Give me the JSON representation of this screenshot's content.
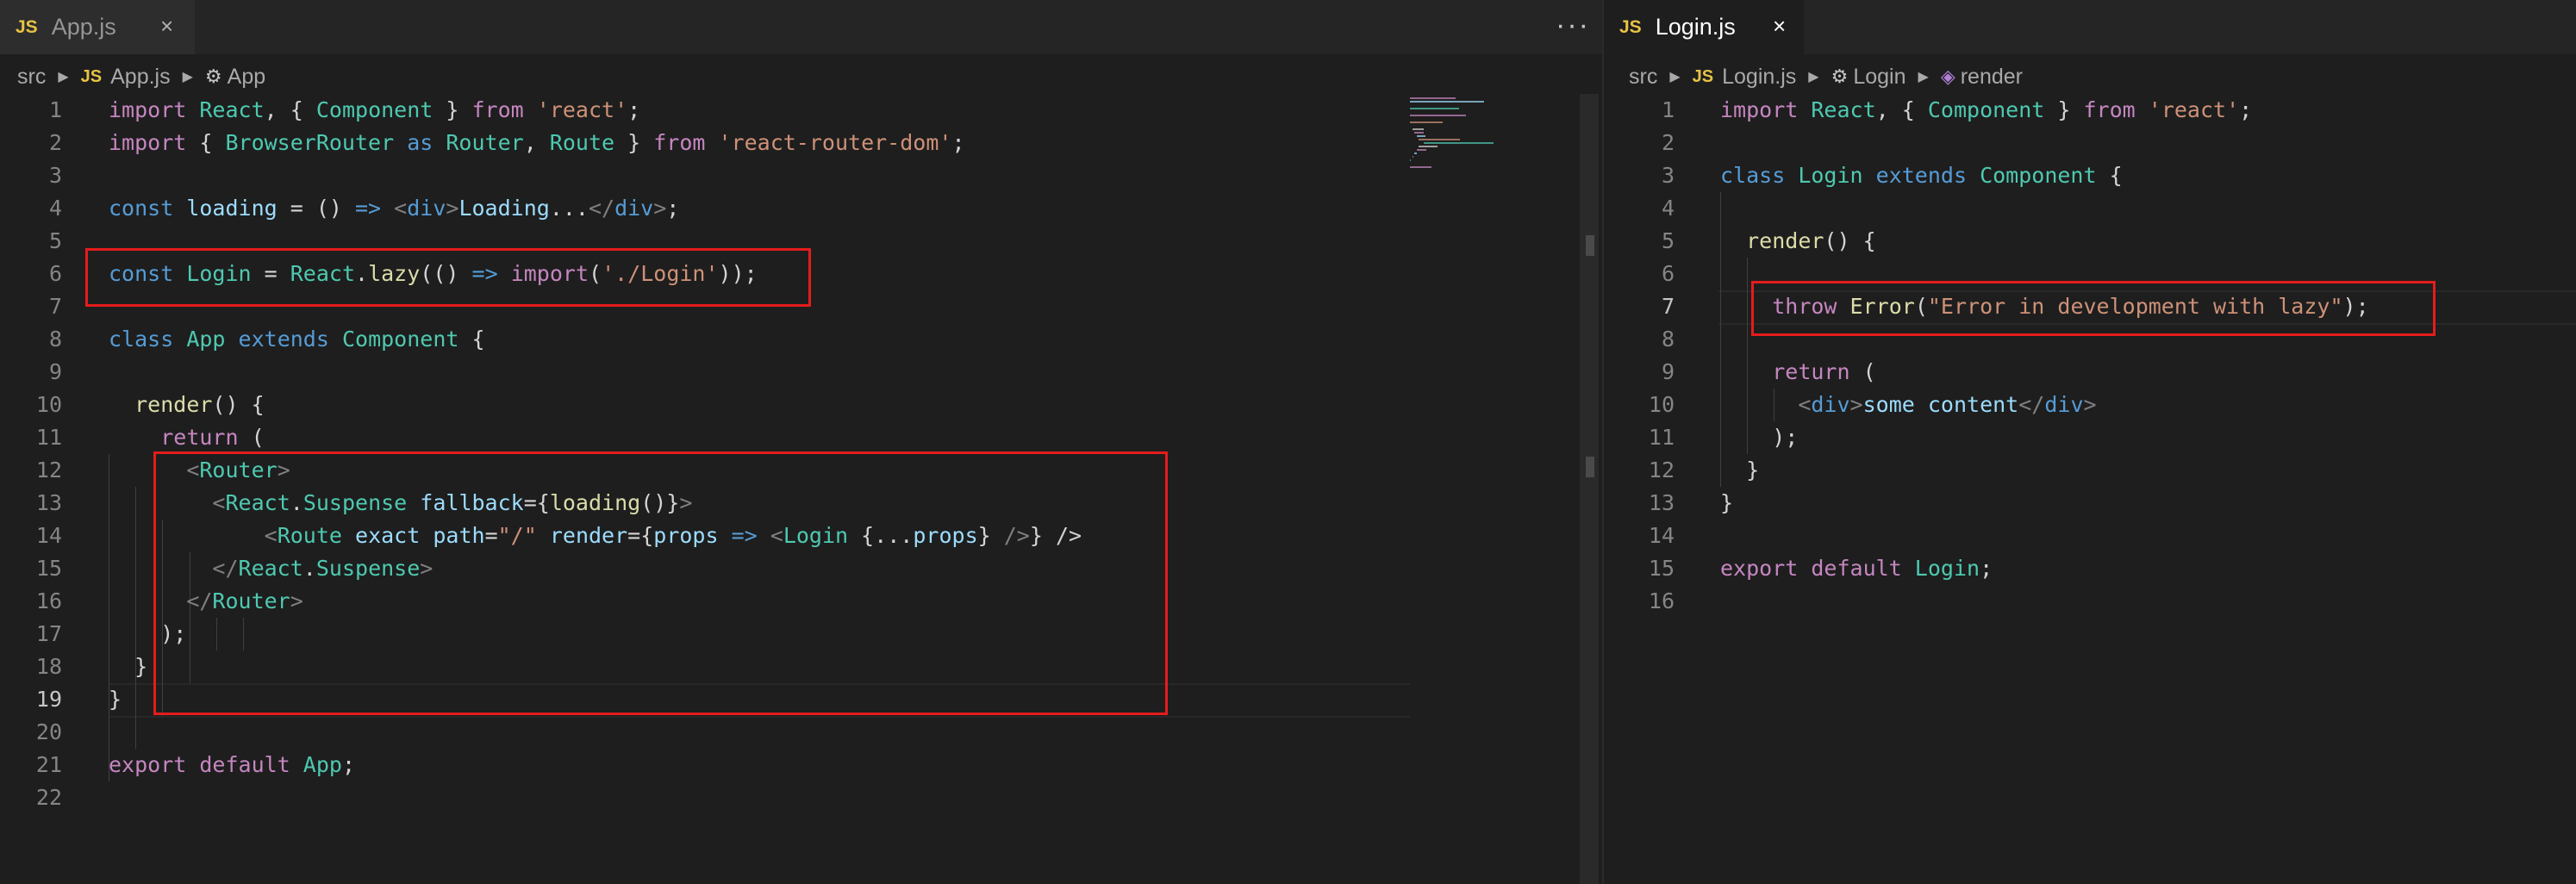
{
  "left": {
    "tabs": [
      {
        "badge": "JS",
        "name": "App.js",
        "close": "×"
      }
    ],
    "more": "···",
    "breadcrumb": {
      "folder": "src",
      "file_badge": "JS",
      "file": "App.js",
      "symbol": "App"
    },
    "active_line": 19,
    "lines": [
      "import React, { Component } from 'react';",
      "import { BrowserRouter as Router, Route } from 'react-router-dom';",
      "",
      "const loading = () => <div>Loading...</div>;",
      "",
      "const Login = React.lazy(() => import('./Login'));",
      "",
      "class App extends Component {",
      "",
      "  render() {",
      "    return (",
      "      <Router>",
      "        <React.Suspense fallback={loading()}>",
      "            <Route exact path=\"/\" render={props => <Login {...props} />} />",
      "        </React.Suspense>",
      "      </Router>",
      "    );",
      "  }",
      "}",
      "",
      "export default App;",
      ""
    ]
  },
  "right": {
    "tabs": [
      {
        "badge": "JS",
        "name": "Login.js",
        "close": "×"
      }
    ],
    "breadcrumb": {
      "folder": "src",
      "file_badge": "JS",
      "file": "Login.js",
      "class": "Login",
      "method": "render"
    },
    "active_line": 7,
    "lines": [
      "import React, { Component } from 'react';",
      "",
      "class Login extends Component {",
      "",
      "  render() {",
      "",
      "    throw Error(\"Error in development with lazy\");",
      "",
      "    return (",
      "      <div>some content</div>",
      "    );",
      "  }",
      "}",
      "",
      "export default Login;",
      ""
    ]
  },
  "colors": {
    "background": "#1e1e1e",
    "highlight_box": "#e51c1c",
    "js_badge": "#e8c345"
  }
}
